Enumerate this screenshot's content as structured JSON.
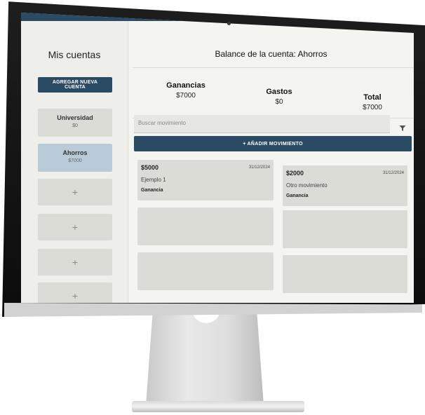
{
  "sidebar": {
    "title": "Mis cuentas",
    "add_account_label": "AGREGAR NUEVA CUENTA",
    "accounts": [
      {
        "name": "Universidad",
        "amount": "$0",
        "selected": false
      },
      {
        "name": "Ahorros",
        "amount": "$7000",
        "selected": true
      }
    ],
    "add_placeholder_symbol": "+"
  },
  "main": {
    "title": "Balance de la cuenta: Ahorros",
    "stats": {
      "ganancias": {
        "label": "Ganancias",
        "value": "$7000"
      },
      "gastos": {
        "label": "Gastos",
        "value": "$0"
      },
      "total": {
        "label": "Total",
        "value": "$7000"
      }
    },
    "search": {
      "placeholder": "Buscar movimiento"
    },
    "filter_icon": "filter-icon",
    "add_movement_label": "+   AÑADIR MOVIMIENTO",
    "movements": [
      {
        "amount": "$5000",
        "date": "31/12/2024",
        "description": "Ejemplo 1",
        "type": "Ganancia"
      },
      {
        "amount": "$2000",
        "date": "31/12/2024",
        "description": "Otro movimiento",
        "type": "Ganancia"
      }
    ]
  },
  "colors": {
    "primary": "#2b4a63",
    "selected_account": "#b9cbd9",
    "card": "#dcdcd6",
    "background": "#f4f5f0"
  }
}
